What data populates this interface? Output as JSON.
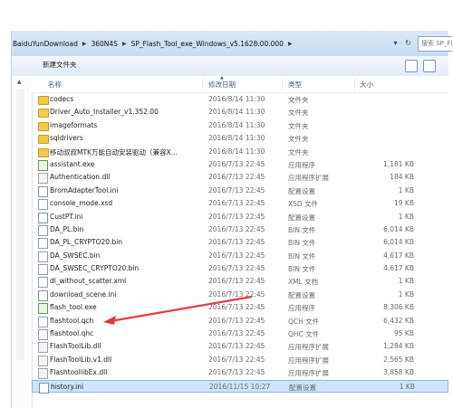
{
  "breadcrumb": [
    "BaiduYunDownload",
    "360N4S",
    "SP_Flash_Tool_exe_Windows_v5.1628.00.000"
  ],
  "search": {
    "text": "搜索 SP_Fl..."
  },
  "toolbar": {
    "new_folder_label": "新建文件夹"
  },
  "columns": {
    "name": "名称",
    "date": "修改日期",
    "type": "类型",
    "size": "大小"
  },
  "files": [
    {
      "name": "codecs",
      "date": "2016/8/14 11:30",
      "type": "文件夹",
      "size": "",
      "icon": "folder-icon"
    },
    {
      "name": "Driver_Auto_Installer_v1.352.00",
      "date": "2016/8/14 11:30",
      "type": "文件夹",
      "size": "",
      "icon": "folder-icon"
    },
    {
      "name": "imageformats",
      "date": "2016/8/14 11:30",
      "type": "文件夹",
      "size": "",
      "icon": "folder-icon"
    },
    {
      "name": "sqldrivers",
      "date": "2016/8/14 11:30",
      "type": "文件夹",
      "size": "",
      "icon": "folder-icon"
    },
    {
      "name": "移动叔叔MTK万能自动安装驱动（兼容X...",
      "date": "2016/8/14 11:30",
      "type": "文件夹",
      "size": "",
      "icon": "folder-icon"
    },
    {
      "name": "assistant.exe",
      "date": "2016/7/13 22:45",
      "type": "应用程序",
      "size": "1,181 KB",
      "icon": "exe-icon"
    },
    {
      "name": "Authentication.dll",
      "date": "2016/7/13 22:45",
      "type": "应用程序扩展",
      "size": "184 KB",
      "icon": "dll-icon"
    },
    {
      "name": "BromAdapterTool.ini",
      "date": "2016/7/13 22:45",
      "type": "配置设置",
      "size": "1 KB",
      "icon": "ini-icon"
    },
    {
      "name": "console_mode.xsd",
      "date": "2016/7/13 22:45",
      "type": "XSD 文件",
      "size": "19 KB",
      "icon": "file-icon"
    },
    {
      "name": "CustPT.ini",
      "date": "2016/7/13 22:45",
      "type": "配置设置",
      "size": "1 KB",
      "icon": "ini-icon"
    },
    {
      "name": "DA_PL.bin",
      "date": "2016/7/13 22:45",
      "type": "BIN 文件",
      "size": "6,014 KB",
      "icon": "file-icon"
    },
    {
      "name": "DA_PL_CRYPTO20.bin",
      "date": "2016/7/13 22:45",
      "type": "BIN 文件",
      "size": "6,014 KB",
      "icon": "file-icon"
    },
    {
      "name": "DA_SWSEC.bin",
      "date": "2016/7/13 22:45",
      "type": "BIN 文件",
      "size": "4,617 KB",
      "icon": "file-icon"
    },
    {
      "name": "DA_SWSEC_CRYPTO20.bin",
      "date": "2016/7/13 22:45",
      "type": "BIN 文件",
      "size": "4,617 KB",
      "icon": "file-icon"
    },
    {
      "name": "dl_without_scatter.xml",
      "date": "2016/7/13 22:45",
      "type": "XML 文档",
      "size": "1 KB",
      "icon": "file-icon"
    },
    {
      "name": "download_scene.ini",
      "date": "2016/7/13 22:45",
      "type": "配置设置",
      "size": "1 KB",
      "icon": "ini-icon"
    },
    {
      "name": "flash_tool.exe",
      "date": "2016/7/13 22:45",
      "type": "应用程序",
      "size": "8,306 KB",
      "icon": "exe-icon"
    },
    {
      "name": "flashtool.qch",
      "date": "2016/7/13 22:45",
      "type": "QCH 文件",
      "size": "6,432 KB",
      "icon": "file-icon"
    },
    {
      "name": "flashtool.qhc",
      "date": "2016/7/13 22:45",
      "type": "QHC 文件",
      "size": "95 KB",
      "icon": "file-icon"
    },
    {
      "name": "FlashToolLib.dll",
      "date": "2016/7/13 22:45",
      "type": "应用程序扩展",
      "size": "1,284 KB",
      "icon": "dll-icon"
    },
    {
      "name": "FlashToolLib.v1.dll",
      "date": "2016/7/13 22:45",
      "type": "应用程序扩展",
      "size": "2,565 KB",
      "icon": "dll-icon"
    },
    {
      "name": "FlashtoollibEx.dll",
      "date": "2016/7/13 22:45",
      "type": "应用程序扩展",
      "size": "3,858 KB",
      "icon": "dll-icon"
    },
    {
      "name": "history.ini",
      "date": "2016/11/15 10:27",
      "type": "配置设置",
      "size": "1 KB",
      "icon": "ini-icon",
      "selected": true
    }
  ],
  "annotation": {
    "color": "#e23b3b",
    "icon": "red-arrow-annotation"
  },
  "colors": {
    "selection": "#cfe3fb",
    "folder": "#f2c94c",
    "address_bar": "#d3e3f5"
  }
}
